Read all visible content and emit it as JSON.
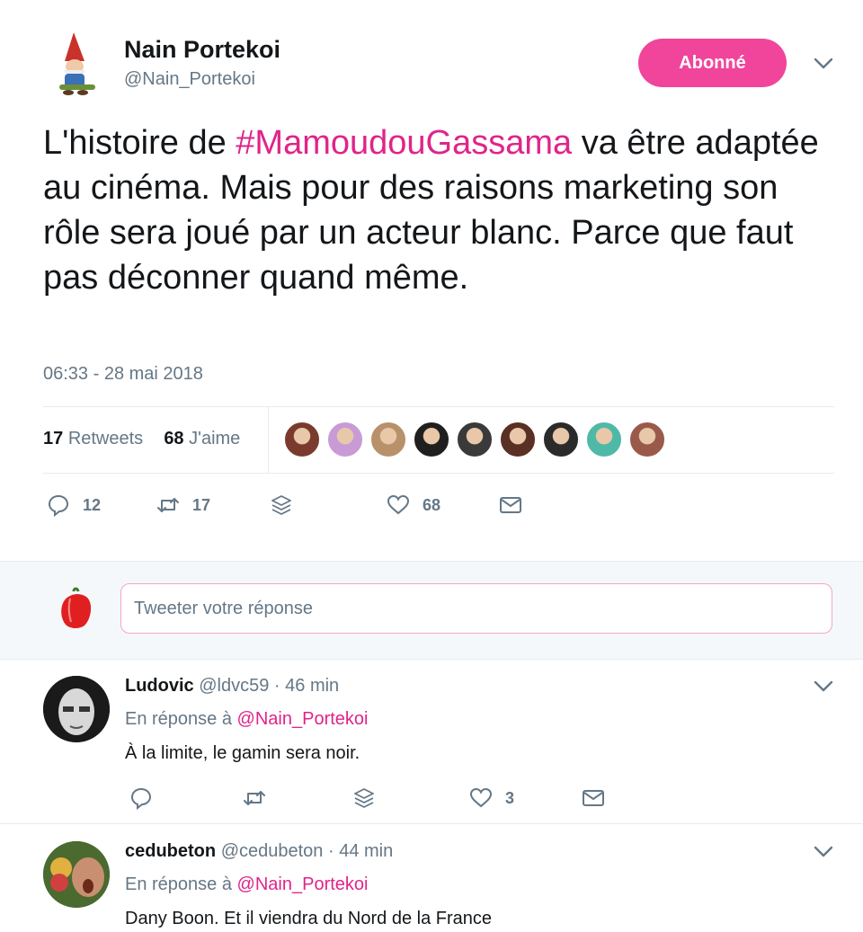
{
  "tweet": {
    "author_name": "Nain Portekoi",
    "author_handle": "@Nain_Portekoi",
    "follow_label": "Abonné",
    "text_before": "L'histoire de ",
    "hashtag": "#MamoudouGassama",
    "text_after": " va être adaptée au cinéma. Mais pour des raisons marketing son rôle sera joué par un acteur blanc. Parce que faut pas déconner quand même.",
    "timestamp": "06:33 - 28 mai 2018",
    "retweets_count": "17",
    "retweets_label": "Retweets",
    "likes_count": "68",
    "likes_label": "J'aime",
    "actions": {
      "reply_count": "12",
      "retweet_count": "17",
      "like_count": "68"
    }
  },
  "liker_avatar_colors": [
    "#7a3b2e",
    "#c99bd6",
    "#b8906a",
    "#1f1f1f",
    "#3a3a3a",
    "#5a2f24",
    "#2b2b2b",
    "#4fb9a8",
    "#9a5a4a"
  ],
  "reply_box": {
    "placeholder": "Tweeter votre réponse"
  },
  "replies": [
    {
      "name": "Ludovic",
      "handle": "@ldvc59",
      "time": "· 46 min",
      "in_reply_prefix": "En réponse à",
      "in_reply_to": "@Nain_Portekoi",
      "text": "À la limite, le gamin sera noir.",
      "like_count": "3"
    },
    {
      "name": "cedubeton",
      "handle": "@cedubeton",
      "time": "· 44 min",
      "in_reply_prefix": "En réponse à",
      "in_reply_to": "@Nain_Portekoi",
      "text": "Dany Boon. Et il viendra du Nord de la France"
    }
  ],
  "colors": {
    "accent": "#f0459b",
    "link": "#e0248a",
    "secondary_text": "#657786"
  }
}
